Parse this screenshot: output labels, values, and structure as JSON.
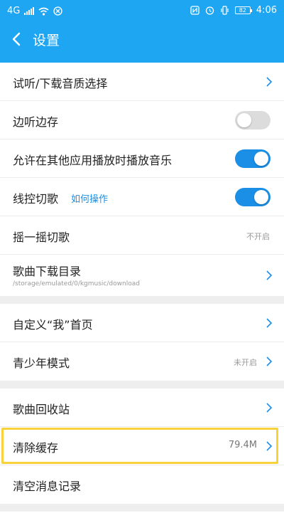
{
  "status_bar": {
    "carrier_signal": "4G",
    "time": "4:06",
    "battery": "82"
  },
  "header": {
    "title": "设置"
  },
  "groups": [
    {
      "items": [
        {
          "label": "试听/下载音质选择",
          "control": "chevron"
        },
        {
          "label": "边听边存",
          "control": "toggle",
          "state": "off"
        },
        {
          "label": "允许在其他应用播放时播放音乐",
          "control": "toggle",
          "state": "on"
        },
        {
          "label": "线控切歌",
          "link": "如何操作",
          "control": "toggle",
          "state": "on"
        },
        {
          "label": "摇一摇切歌",
          "value": "不开启"
        },
        {
          "label": "歌曲下载目录",
          "sublabel": "/storage/emulated/0/kgmusic/download",
          "control": "chevron"
        }
      ]
    },
    {
      "items": [
        {
          "label": "自定义“我”首页",
          "control": "chevron"
        },
        {
          "label": "青少年模式",
          "value": "未开启",
          "control": "chevron"
        }
      ]
    },
    {
      "items": [
        {
          "label": "歌曲回收站",
          "control": "chevron"
        },
        {
          "label": "清除缓存",
          "value": "79.4M",
          "control": "chevron",
          "highlighted": true
        },
        {
          "label": "清空消息记录"
        }
      ]
    }
  ],
  "colors": {
    "header_bg": "#1fa6f2",
    "toggle_on": "#1b8fe6",
    "toggle_off": "#dcdcdc",
    "highlight": "#f7d23a"
  }
}
